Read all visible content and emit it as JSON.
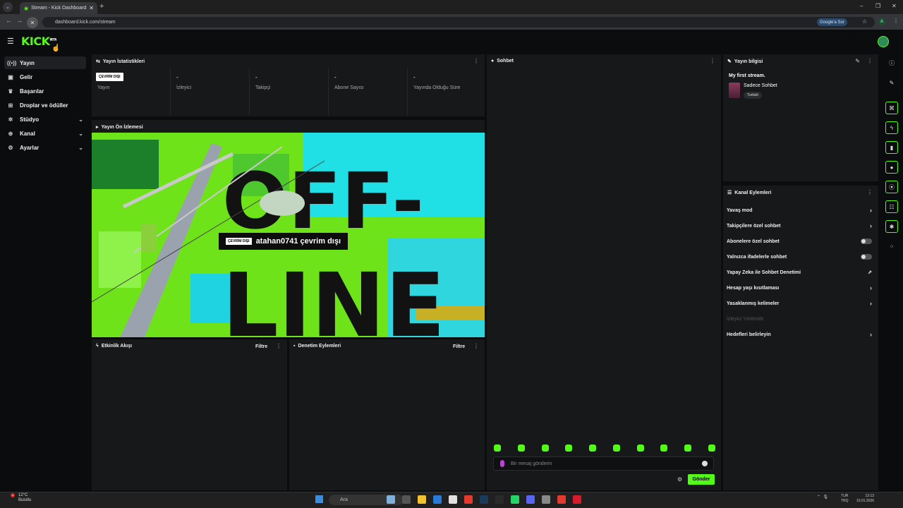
{
  "browser": {
    "tab_title": "Stream - Kick Dashboard",
    "tab_close": "✕",
    "new_tab": "+",
    "tab_menu": "⌄",
    "back": "←",
    "forward": "→",
    "reload": "✕",
    "url": "dashboard.kick.com/stream",
    "google_sor": "Google'a Sor",
    "star": "☆",
    "profile_letter": "A",
    "menu": "⋮",
    "minimize": "–",
    "maximize": "❐",
    "close": "✕"
  },
  "header": {
    "logo": "KICK",
    "logo_sup": "BETA",
    "hamburger": "☰"
  },
  "sidebar": {
    "items": [
      {
        "label": "Yayın",
        "icon": "broadcast-icon",
        "glyph": "((•))",
        "active": true,
        "expandable": false
      },
      {
        "label": "Gelir",
        "icon": "wallet-icon",
        "glyph": "▣",
        "active": false,
        "expandable": false
      },
      {
        "label": "Başarılar",
        "icon": "trophy-icon",
        "glyph": "♛",
        "active": false,
        "expandable": false
      },
      {
        "label": "Droplar ve ödüller",
        "icon": "gift-icon",
        "glyph": "⊞",
        "active": false,
        "expandable": false
      },
      {
        "label": "Stüdyo",
        "icon": "studio-icon",
        "glyph": "✲",
        "active": false,
        "expandable": true
      },
      {
        "label": "Kanal",
        "icon": "channel-icon",
        "glyph": "⊕",
        "active": false,
        "expandable": true
      },
      {
        "label": "Ayarlar",
        "icon": "gear-icon",
        "glyph": "⚙",
        "active": false,
        "expandable": true
      }
    ]
  },
  "stats": {
    "title": "Yayın İstatistikleri",
    "offline_badge": "ÇEVRİM DIŞI",
    "columns": [
      {
        "value": "",
        "label": "Yayın"
      },
      {
        "value": "-",
        "label": "İzleyici"
      },
      {
        "value": "-",
        "label": "Takipçi"
      },
      {
        "value": "-",
        "label": "Abone Sayısı"
      },
      {
        "value": "-",
        "label": "Yayında Olduğu Süre"
      }
    ]
  },
  "preview": {
    "title": "Yayın Ön İzlemesi",
    "offline_badge": "ÇEVRİM DIŞI",
    "offline_text": "atahan0741 çevrim dışı",
    "big_text_top": "OFF-",
    "big_text_bottom": "LINE"
  },
  "activity": {
    "title": "Etkinlik Akışı",
    "filter": "Filtre"
  },
  "moderation": {
    "title": "Denetim Eylemleri",
    "filter": "Filtre"
  },
  "chat": {
    "title": "Sohbet",
    "placeholder": "Bir mesaj gönderin",
    "send": "Gönder",
    "emote_count": 10
  },
  "stream_info": {
    "title": "Yayın bilgisi",
    "stream_title": "My first stream.",
    "category": "Sadece Sohbet",
    "tag": "Turkish"
  },
  "channel_actions": {
    "title": "Kanal Eylemleri",
    "rows": [
      {
        "label": "Yavaş mod",
        "control": "chevron"
      },
      {
        "label": "Takipçilere özel sohbet",
        "control": "chevron"
      },
      {
        "label": "Abonelere özel sohbet",
        "control": "toggle"
      },
      {
        "label": "Yalnızca ifadelerle sohbet",
        "control": "toggle"
      },
      {
        "label": "Yapay Zeka ile Sohbet Denetimi",
        "control": "external"
      },
      {
        "label": "Hesap yaşı kısıtlaması",
        "control": "chevron"
      },
      {
        "label": "Yasaklanmış kelimeler",
        "control": "chevron"
      },
      {
        "label": "İzleyici Yönlendir",
        "control": "none",
        "dim": true
      },
      {
        "label": "Hedefleri belirleyin",
        "control": "chevron"
      }
    ]
  },
  "taskbar": {
    "weather_temp": "12°C",
    "weather_desc": "Bulutlu",
    "weather_badge": "4",
    "search": "Ara",
    "lang_top": "TUR",
    "lang_bottom": "TRQ",
    "time": "13:13",
    "date": "10.01.2026"
  },
  "colors": {
    "accent": "#53fc18",
    "panel": "#17181a",
    "bg": "#0b0c0d"
  }
}
